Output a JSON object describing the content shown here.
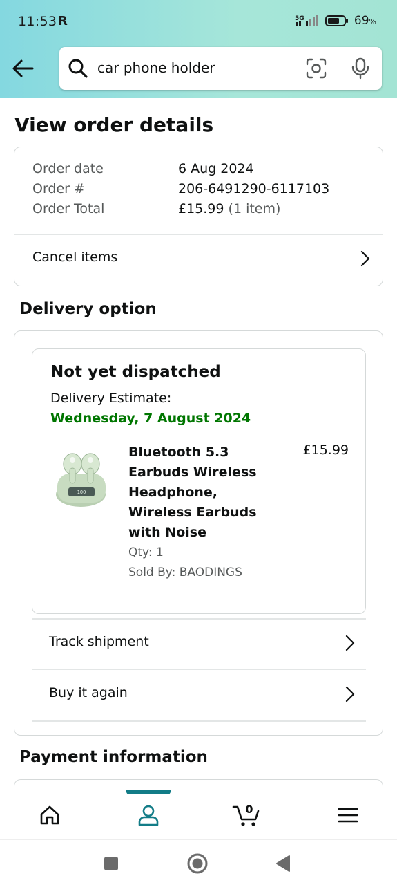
{
  "status_bar": {
    "time": "11:53",
    "r_icon": "R",
    "battery": "69",
    "battery_unit": "%",
    "network": "5G"
  },
  "search": {
    "query": "car phone holder"
  },
  "page": {
    "title": "View order details"
  },
  "order": {
    "date_label": "Order date",
    "date_value": "6 Aug 2024",
    "number_label": "Order #",
    "number_value": "206-6491290-6117103",
    "total_label": "Order Total",
    "total_value": "£15.99",
    "total_items": "(1 item)",
    "cancel_label": "Cancel items"
  },
  "delivery": {
    "section_title": "Delivery option",
    "status": "Not yet dispatched",
    "estimate_label": "Delivery Estimate:",
    "estimate_date": "Wednesday, 7 August 2024",
    "product": {
      "name": "Bluetooth 5.3 Earbuds Wireless Headphone, Wireless Earbuds with Noise",
      "price": "£15.99",
      "qty": "Qty: 1",
      "seller": "Sold By: BAODINGS"
    },
    "track_label": "Track shipment",
    "buy_again_label": "Buy it again"
  },
  "payment": {
    "section_title": "Payment information"
  },
  "bottom_nav": {
    "cart_count": "0",
    "active": "account"
  },
  "colors": {
    "accent_teal": "#127c87",
    "delivery_green": "#007600"
  }
}
